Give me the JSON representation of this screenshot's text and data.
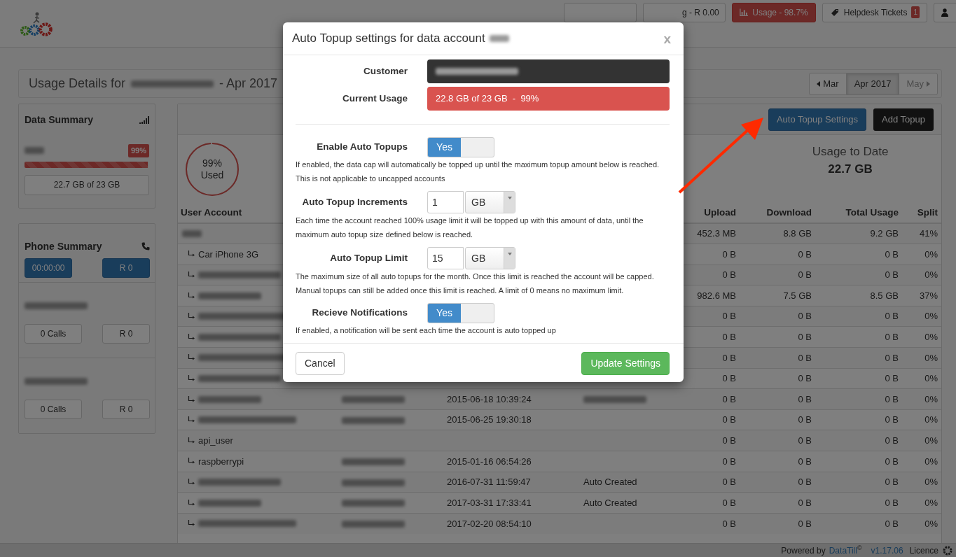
{
  "navbar": {
    "buttons": [
      {
        "kind": "plain"
      },
      {
        "kind": "plain",
        "label": "g - R 0.00"
      },
      {
        "kind": "usage",
        "label": "Usage - 98.7%"
      },
      {
        "kind": "tickets",
        "label": "Helpdesk Tickets",
        "badge": "1"
      },
      {
        "kind": "user"
      }
    ]
  },
  "page_title": {
    "prefix": "Usage Details for",
    "suffix": "- Apr 2017"
  },
  "month_pager": [
    {
      "kind": "prev",
      "label": "Mar",
      "selected": false,
      "disabled": false
    },
    {
      "kind": "current",
      "label": "Apr 2017",
      "selected": true,
      "disabled": false
    },
    {
      "kind": "next",
      "label": "May",
      "selected": false,
      "disabled": true
    }
  ],
  "data_summary": {
    "title": "Data Summary",
    "badge": "99%",
    "level": 0.99,
    "total": "22.7 GB of 23 GB"
  },
  "phone_summary": {
    "title": "Phone Summary",
    "duration": "00:00:00",
    "cost": "R 0",
    "lines": [
      {
        "calls": "0 Calls",
        "cost": "R 0"
      },
      {
        "calls": "0 Calls",
        "cost": "R 0"
      }
    ]
  },
  "main": {
    "actions": [
      {
        "kind": "primary",
        "label": "Auto Topup Settings"
      },
      {
        "kind": "dark",
        "label": "Add Topup"
      }
    ],
    "usage_ring": {
      "value": "99%",
      "caption": "Used",
      "level": 0.99
    },
    "usage_to_date": {
      "label": "Usage to Date",
      "value": "22.7 GB"
    }
  },
  "table": {
    "columns": [
      "User Account",
      "Upload",
      "Download",
      "Total Usage",
      "Split"
    ],
    "rows": [
      {
        "account_blurred": true,
        "upload": "452.3 MB",
        "download": "8.8 GB",
        "total_usage": "9.2 GB",
        "split": "41%",
        "children": [
          {
            "account": "Car iPhone 3G",
            "account_blurred": false,
            "upload": "0 B",
            "download": "0 B",
            "total_usage": "0 B",
            "split": "0%"
          },
          {
            "account_blurred": true,
            "upload": "0 B",
            "download": "0 B",
            "total_usage": "0 B",
            "split": "0%"
          },
          {
            "account_blurred": true,
            "upload": "982.6 MB",
            "download": "7.5 GB",
            "total_usage": "8.5 GB",
            "split": "37%"
          },
          {
            "account_blurred": true,
            "upload": "0 B",
            "download": "0 B",
            "total_usage": "0 B",
            "split": "0%"
          },
          {
            "account_blurred": true,
            "upload": "0 B",
            "download": "0 B",
            "total_usage": "0 B",
            "split": "0%"
          },
          {
            "account_blurred": true,
            "upload": "0 B",
            "download": "0 B",
            "total_usage": "0 B",
            "split": "0%"
          },
          {
            "account_blurred": true,
            "upload": "0 B",
            "download": "0 B",
            "total_usage": "0 B",
            "split": "0%"
          },
          {
            "account_blurred": true,
            "column_2_blurred": true,
            "column_3": "2015-06-18 10:39:24",
            "column_4_blurred": true,
            "upload": "0 B",
            "download": "0 B",
            "total_usage": "0 B",
            "split": "0%"
          },
          {
            "account_blurred": true,
            "column_2_blurred": true,
            "column_3": "2015-06-25 19:30:18",
            "upload": "0 B",
            "download": "0 B",
            "total_usage": "0 B",
            "split": "0%"
          },
          {
            "account": "api_user",
            "account_blurred": false,
            "upload": "0 B",
            "download": "0 B",
            "total_usage": "0 B",
            "split": "0%"
          },
          {
            "account": "raspberrypi",
            "account_blurred": false,
            "column_2_blurred": true,
            "column_3": "2015-01-16 06:54:26",
            "upload": "0 B",
            "download": "0 B",
            "total_usage": "0 B",
            "split": "0%"
          },
          {
            "account_blurred": true,
            "column_2_blurred": true,
            "column_3": "2016-07-31 11:59:47",
            "column_4": "Auto Created",
            "upload": "0 B",
            "download": "0 B",
            "total_usage": "0 B",
            "split": "0%"
          },
          {
            "account_blurred": true,
            "column_2_blurred": true,
            "column_3": "2017-03-31 17:33:41",
            "column_4": "Auto Created",
            "upload": "0 B",
            "download": "0 B",
            "total_usage": "0 B",
            "split": "0%"
          },
          {
            "account_blurred": true,
            "column_2_blurred": true,
            "column_3": "2017-02-20 08:54:10",
            "upload": "0 B",
            "download": "0 B",
            "total_usage": "0 B",
            "split": "0%"
          }
        ]
      }
    ]
  },
  "footer": {
    "powered_by": "Powered by",
    "brand": "DataTill",
    "copyright": "©",
    "version": "v1.17.06",
    "licence": "Licence"
  },
  "modal": {
    "title": "Auto Topup settings for data account",
    "close": "x",
    "customer": {
      "label": "Customer"
    },
    "current_usage": {
      "label": "Current Usage",
      "value": "22.8 GB of 23 GB  -  99%"
    },
    "fields": [
      {
        "kind": "toggle",
        "label": "Enable Auto Topups",
        "on": true,
        "on_label": "Yes",
        "help": "If enabled, the data cap will automatically be topped up until the maximum topup amount below is reached. This is not applicable to uncapped accounts"
      },
      {
        "kind": "amount",
        "label": "Auto Topup Increments",
        "value": "1",
        "unit": "GB",
        "help": "Each time the account reached 100% usage limit it will be topped up with this amount of data, until the maximum auto topup size defined below is reached."
      },
      {
        "kind": "amount",
        "label": "Auto Topup Limit",
        "value": "15",
        "unit": "GB",
        "help": "The maximum size of all auto topups for the month. Once this limit is reached the account will be capped. Manual topups can still be added once this limit is reached. A limit of 0 means no maximum limit."
      },
      {
        "kind": "toggle",
        "label": "Recieve Notifications",
        "on": true,
        "on_label": "Yes",
        "help": "If enabled, a notification will be sent each time the account is auto topped up"
      }
    ],
    "buttons": [
      {
        "kind": "cancel",
        "label": "Cancel"
      },
      {
        "kind": "submit",
        "label": "Update Settings"
      }
    ]
  }
}
